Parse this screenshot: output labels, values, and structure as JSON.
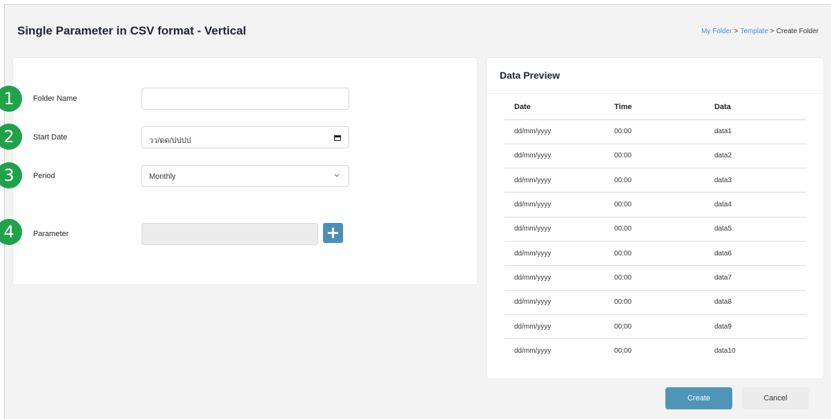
{
  "page": {
    "title": "Single Parameter in CSV format - Vertical"
  },
  "breadcrumb": {
    "items": [
      {
        "label": "My Folder",
        "link": true
      },
      {
        "label": "Template",
        "link": true
      },
      {
        "label": "Create Folder",
        "link": false
      }
    ],
    "separator": ">"
  },
  "form": {
    "folder_name": {
      "badge": "1",
      "label": "Folder Name",
      "value": ""
    },
    "start_date": {
      "badge": "2",
      "label": "Start Date",
      "value": "วว/ดด/ปปปป"
    },
    "period": {
      "badge": "3",
      "label": "Period",
      "value": "Monthly"
    },
    "parameter": {
      "badge": "4",
      "label": "Parameter",
      "value": ""
    }
  },
  "preview": {
    "title": "Data Preview",
    "columns": [
      "Date",
      "Time",
      "Data"
    ],
    "rows": [
      [
        "dd/mm/yyyy",
        "00:00",
        "data1"
      ],
      [
        "dd/mm/yyyy",
        "00:00",
        "data2"
      ],
      [
        "dd/mm/yyyy",
        "00:00",
        "data3"
      ],
      [
        "dd/mm/yyyy",
        "00:00",
        "data4"
      ],
      [
        "dd/mm/yyyy",
        "00:00",
        "data5"
      ],
      [
        "dd/mm/yyyy",
        "00:00",
        "data6"
      ],
      [
        "dd/mm/yyyy",
        "00:00",
        "data7"
      ],
      [
        "dd/mm/yyyy",
        "00:00",
        "data8"
      ],
      [
        "dd/mm/yyyy",
        "00:00",
        "data9"
      ],
      [
        "dd/mm/yyyy",
        "00:00",
        "data10"
      ]
    ]
  },
  "actions": {
    "create_label": "Create",
    "cancel_label": "Cancel"
  },
  "colors": {
    "accent": "#4e95b8",
    "badge": "#1fa24a",
    "link": "#4a8fd8"
  },
  "icons": {
    "date": "calendar-icon",
    "period": "chevron-down-icon",
    "add": "plus-icon"
  }
}
